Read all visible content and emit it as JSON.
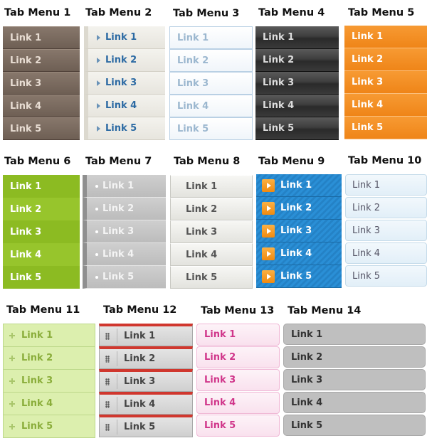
{
  "menus": [
    {
      "title": "Tab Menu 1",
      "links": [
        "Link 1",
        "Link 2",
        "Link 3",
        "Link 4",
        "Link 5"
      ]
    },
    {
      "title": "Tab Menu 2",
      "links": [
        "Link 1",
        "Link 2",
        "Link 3",
        "Link 4",
        "Link 5"
      ]
    },
    {
      "title": "Tab Menu 3",
      "links": [
        "Link 1",
        "Link 2",
        "Link 3",
        "Link 4",
        "Link 5"
      ]
    },
    {
      "title": "Tab Menu 4",
      "links": [
        "Link 1",
        "Link 2",
        "Link 3",
        "Link 4",
        "Link 5"
      ]
    },
    {
      "title": "Tab Menu 5",
      "links": [
        "Link 1",
        "Link 2",
        "Link 3",
        "Link 4",
        "Link 5"
      ]
    },
    {
      "title": "Tab Menu 6",
      "links": [
        "Link 1",
        "Link 2",
        "Link 3",
        "Link 4",
        "Link 5"
      ]
    },
    {
      "title": "Tab Menu 7",
      "links": [
        "Link 1",
        "Link 2",
        "Link 3",
        "Link 4",
        "Link 5"
      ]
    },
    {
      "title": "Tab Menu 8",
      "links": [
        "Link 1",
        "Link 2",
        "Link 3",
        "Link 4",
        "Link 5"
      ]
    },
    {
      "title": "Tab Menu 9",
      "links": [
        "Link 1",
        "Link 2",
        "Link 3",
        "Link 4",
        "Link 5"
      ]
    },
    {
      "title": "Tab Menu 10",
      "links": [
        "Link 1",
        "Link 2",
        "Link 3",
        "Link 4",
        "Link 5"
      ]
    },
    {
      "title": "Tab Menu 11",
      "links": [
        "Link 1",
        "Link 2",
        "Link 3",
        "Link 4",
        "Link 5"
      ]
    },
    {
      "title": "Tab Menu 12",
      "links": [
        "Link 1",
        "Link 2",
        "Link 3",
        "Link 4",
        "Link 5"
      ]
    },
    {
      "title": "Tab Menu 13",
      "links": [
        "Link 1",
        "Link 2",
        "Link 3",
        "Link 4",
        "Link 5"
      ]
    },
    {
      "title": "Tab Menu 14",
      "links": [
        "Link 1",
        "Link 2",
        "Link 3",
        "Link 4",
        "Link 5"
      ]
    }
  ],
  "icons": {
    "menu2": "chevron-right-icon",
    "menu7": "bullet-icon",
    "menu9": "play-icon",
    "menu11": "plus-icon",
    "menu12": "grip-icon"
  },
  "colors": {
    "menu1": "#7a6a5e",
    "menu2": "#2c6aa3",
    "menu3": "#9bb7cf",
    "menu4": "#3a3a3a",
    "menu5": "#f08a1c",
    "menu6": "#94c128",
    "menu7": "#c4c4c4",
    "menu8": "#ececea",
    "menu9": "#2a8fd6",
    "menu10": "#e6f1f9",
    "menu11": "#dcefae",
    "menu12": "#d0372e",
    "menu13": "#d0358a",
    "menu14": "#bfbfbf"
  }
}
